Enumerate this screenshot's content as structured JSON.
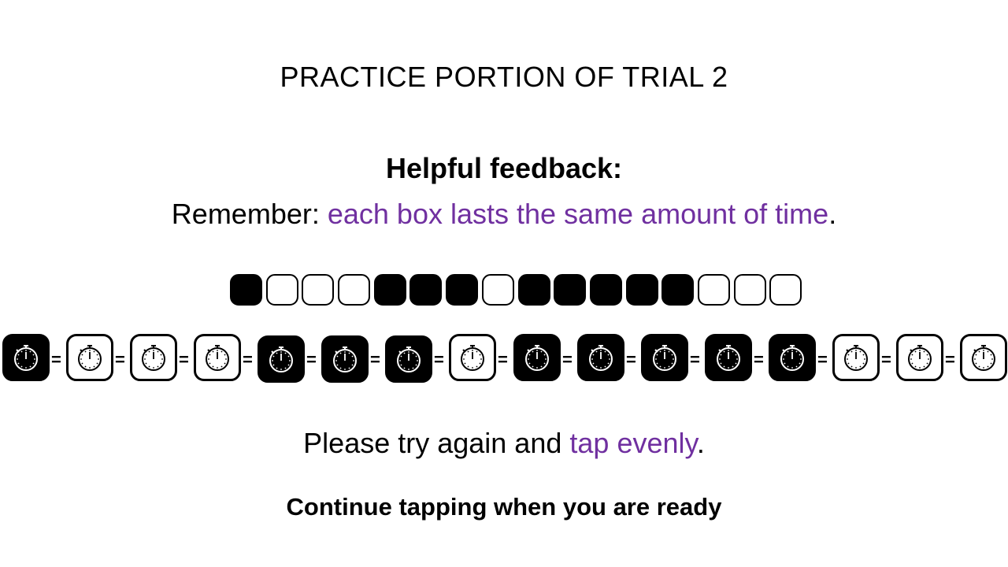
{
  "title": "PRACTICE PORTION OF TRIAL 2",
  "feedback": {
    "heading": "Helpful feedback:",
    "remember_prefix": "Remember: ",
    "remember_highlight": "each box lasts the same amount of time",
    "remember_suffix": "."
  },
  "tap_pattern": [
    1,
    0,
    0,
    0,
    1,
    1,
    1,
    0,
    1,
    1,
    1,
    1,
    1,
    0,
    0,
    0
  ],
  "timer_boxes": [
    1,
    0,
    0,
    0,
    1,
    1,
    1,
    0,
    1,
    1,
    1,
    1,
    1,
    0,
    0,
    0
  ],
  "equals_sign": "=",
  "try_again": {
    "prefix": "Please try again and ",
    "highlight": "tap evenly",
    "suffix": "."
  },
  "continue_text": "Continue tapping when you are ready",
  "colors": {
    "accent": "#7030a0",
    "filled": "#000000",
    "empty": "#ffffff"
  },
  "icons": {
    "timer": "stopwatch-icon"
  }
}
